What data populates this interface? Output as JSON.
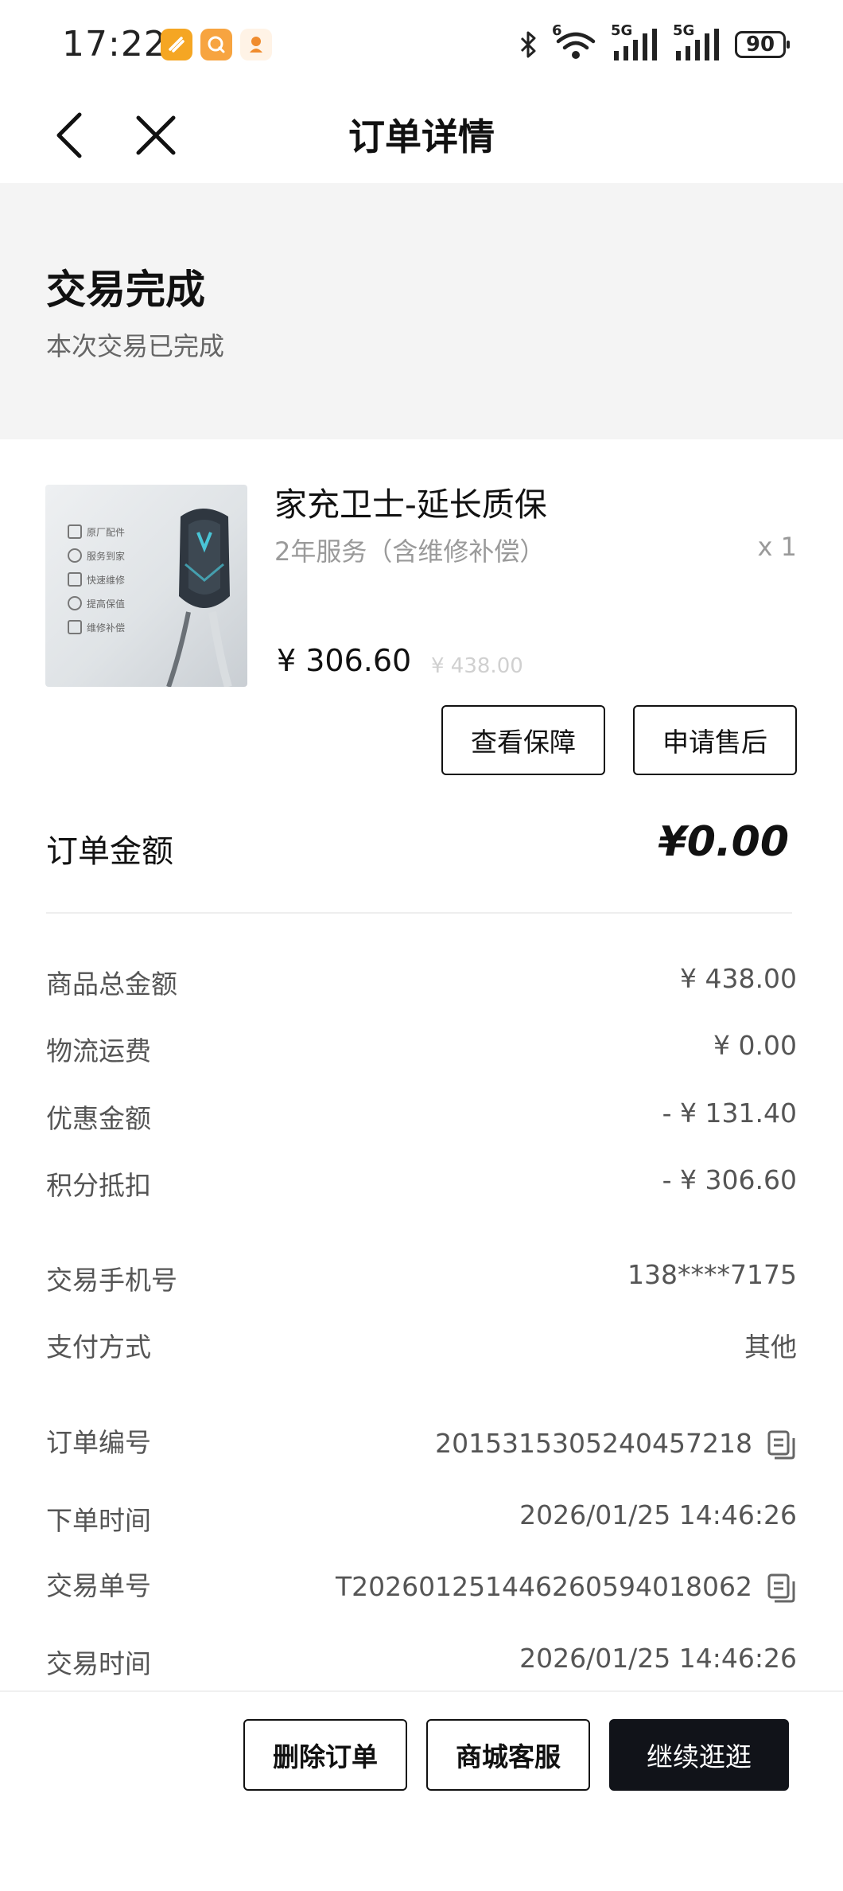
{
  "status_bar": {
    "time": "17:22",
    "battery": "90",
    "network_1": "5G",
    "network_2": "5G",
    "wifi_badge": "6"
  },
  "nav": {
    "title": "订单详情"
  },
  "order_status": {
    "title": "交易完成",
    "subtitle": "本次交易已完成"
  },
  "product": {
    "name": "家充卫士-延长质保",
    "variant": "2年服务（含维修补偿）",
    "quantity": "x 1",
    "price": "¥ 306.60",
    "original_price": "¥ 438.00",
    "image_labels": [
      "原厂配件",
      "服务到家",
      "快速维修",
      "提高保值",
      "维修补偿"
    ],
    "buttons": {
      "view_warranty": "查看保障",
      "after_sales": "申请售后"
    }
  },
  "order_amount": {
    "label": "订单金额",
    "value": "¥0.00"
  },
  "price_rows": [
    {
      "label": "商品总金额",
      "value": "¥ 438.00"
    },
    {
      "label": "物流运费",
      "value": "¥ 0.00"
    },
    {
      "label": "优惠金额",
      "value": "- ¥ 131.40"
    },
    {
      "label": "积分抵扣",
      "value": "- ¥ 306.60"
    }
  ],
  "payment_rows": [
    {
      "label": "交易手机号",
      "value": "138****7175"
    },
    {
      "label": "支付方式",
      "value": "其他"
    }
  ],
  "info_rows": [
    {
      "label": "订单编号",
      "value": "2015315305240457218"
    },
    {
      "label": "下单时间",
      "value": "2026/01/25 14:46:26"
    },
    {
      "label": "交易单号",
      "value": "T202601251446260594018062"
    },
    {
      "label": "交易时间",
      "value": "2026/01/25 14:46:26"
    }
  ],
  "bottom_bar": {
    "delete_order": "删除订单",
    "customer_service": "商城客服",
    "continue_shopping": "继续逛逛"
  },
  "colors": {
    "accent_dark": "#111319",
    "status_bg": "#f4f4f4",
    "secondary_text": "#555555",
    "muted_text": "#9a9a9a"
  }
}
